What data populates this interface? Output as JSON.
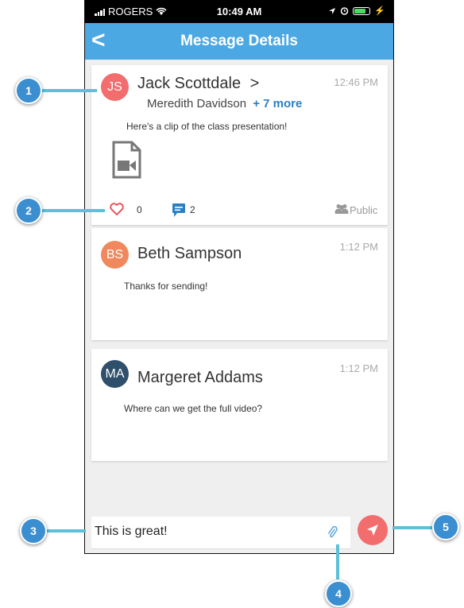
{
  "status": {
    "carrier": "ROGERS",
    "time": "10:49 AM"
  },
  "nav": {
    "back": "<",
    "title": "Message Details"
  },
  "post": {
    "initials": "JS",
    "sender": "Jack Scottdale",
    "arrow": ">",
    "recipient": "Meredith Davidson",
    "more": "+ 7 more",
    "time": "12:46 PM",
    "text": "Here's a clip of the class presentation!",
    "likes": "0",
    "comments": "2",
    "visibility": "Public"
  },
  "replies": [
    {
      "initials": "BS",
      "name": "Beth Sampson",
      "time": "1:12 PM",
      "text": "Thanks for sending!",
      "color": "#f0885e"
    },
    {
      "initials": "MA",
      "name": "Margeret Addams",
      "time": "1:12 PM",
      "text": "Where can we get the full video?",
      "color": "#2f4f6b"
    }
  ],
  "composer": {
    "value": "This is great!"
  },
  "callouts": [
    "1",
    "2",
    "3",
    "4",
    "5"
  ],
  "colors": {
    "accent": "#4ba8e3",
    "send": "#f26d6d",
    "callout": "#3b8ed0",
    "like": "#e5484d"
  },
  "icons": [
    "wifi-icon",
    "location-icon",
    "alarm-icon",
    "battery-icon",
    "video-file-icon",
    "heart-icon",
    "comment-icon",
    "group-icon",
    "paperclip-icon",
    "send-icon"
  ]
}
